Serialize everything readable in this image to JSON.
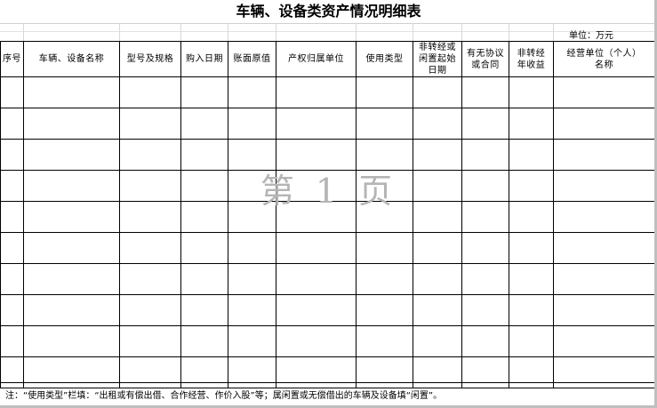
{
  "title": "车辆、设备类资产情况明细表",
  "unit_label": "单位：万元",
  "columns": [
    "序号",
    "车辆、设备名称",
    "型号及规格",
    "购入日期",
    "账面原值",
    "产权归属单位",
    "使用类型",
    "非转经或\n闲置起始\n日期",
    "有无协议\n或合同",
    "非转经\n年收益",
    "经营单位（个人）\n名称"
  ],
  "rows": [
    [
      "",
      "",
      "",
      "",
      "",
      "",
      "",
      "",
      "",
      "",
      ""
    ],
    [
      "",
      "",
      "",
      "",
      "",
      "",
      "",
      "",
      "",
      "",
      ""
    ],
    [
      "",
      "",
      "",
      "",
      "",
      "",
      "",
      "",
      "",
      "",
      ""
    ],
    [
      "",
      "",
      "",
      "",
      "",
      "",
      "",
      "",
      "",
      "",
      ""
    ],
    [
      "",
      "",
      "",
      "",
      "",
      "",
      "",
      "",
      "",
      "",
      ""
    ],
    [
      "",
      "",
      "",
      "",
      "",
      "",
      "",
      "",
      "",
      "",
      ""
    ],
    [
      "",
      "",
      "",
      "",
      "",
      "",
      "",
      "",
      "",
      "",
      ""
    ],
    [
      "",
      "",
      "",
      "",
      "",
      "",
      "",
      "",
      "",
      "",
      ""
    ],
    [
      "",
      "",
      "",
      "",
      "",
      "",
      "",
      "",
      "",
      "",
      ""
    ],
    [
      "",
      "",
      "",
      "",
      "",
      "",
      "",
      "",
      "",
      "",
      ""
    ]
  ],
  "watermark": "第 1 页",
  "note": "注：“使用类型”栏填：“出租或有偿出借、合作经营、作价入股”等；属闲置或无偿借出的车辆及设备填“闲置”。"
}
